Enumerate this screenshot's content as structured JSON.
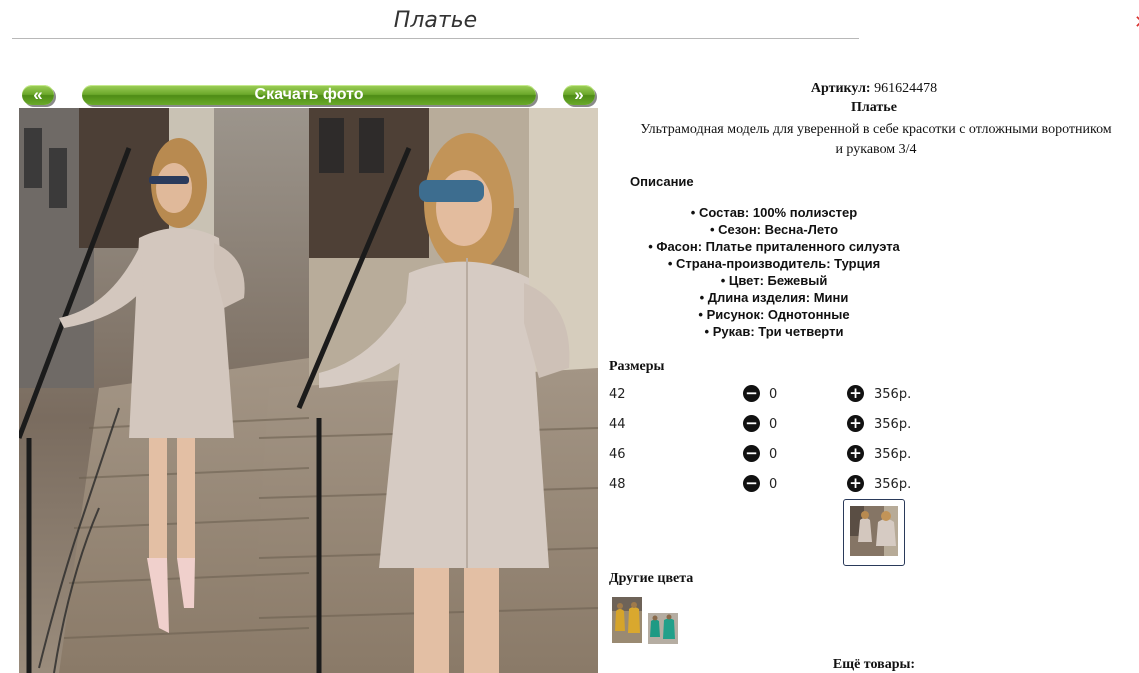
{
  "header": {
    "title": "Платье"
  },
  "gallery": {
    "prev_label": "«",
    "download_label": "Скачать фото",
    "next_label": "»"
  },
  "product": {
    "article_label": "Артикул:",
    "article_value": "961624478",
    "name": "Платье",
    "description": "Ультрамодная модель для уверенной в себе красотки с отложными воротником и рукавом 3/4",
    "details_heading": "Описание",
    "properties": [
      "Состав: 100% полиэстер",
      "Сезон: Весна-Лето",
      "Фасон: Платье приталенного силуэта",
      "Страна-производитель: Турция",
      "Цвет: Бежевый",
      "Длина изделия: Мини",
      "Рисунок: Однотонные",
      "Рукав: Три четверти"
    ]
  },
  "sizes": {
    "heading": "Размеры",
    "rows": [
      {
        "size": "42",
        "qty": "0",
        "price": "356р."
      },
      {
        "size": "44",
        "qty": "0",
        "price": "356р."
      },
      {
        "size": "46",
        "qty": "0",
        "price": "356р."
      },
      {
        "size": "48",
        "qty": "0",
        "price": "356р."
      }
    ],
    "minus_glyph": "−",
    "plus_glyph": "+"
  },
  "other_colors": {
    "heading": "Другие цвета"
  },
  "more_products": {
    "heading": "Ещё товары:"
  },
  "colors": {
    "accent_green": "#6aa72a",
    "dress_beige": "#d2c5bd"
  }
}
